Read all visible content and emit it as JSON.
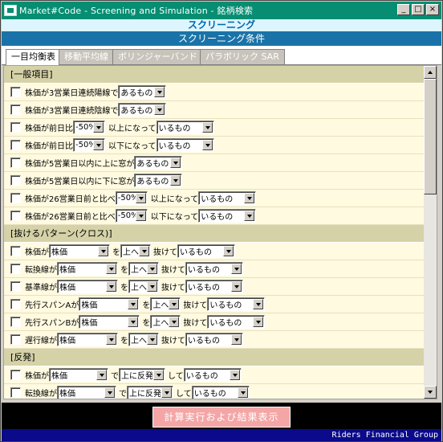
{
  "window": {
    "title": "Market#Code - Screening and Simulation -    銘柄検索"
  },
  "header": {
    "title": "スクリーニング",
    "subtitle": "スクリーニング条件"
  },
  "tabs": [
    {
      "label": "一目均衡表",
      "active": true
    },
    {
      "label": "移動平均線",
      "active": false
    },
    {
      "label": "ボリンジャーバンド",
      "active": false
    },
    {
      "label": "パラボリック SAR",
      "active": false
    }
  ],
  "sections": {
    "general": "[一般項目]",
    "cross": "[抜けるパターン(クロス)]",
    "rebound": "[反発]"
  },
  "labels": {
    "rise3": "株価が3営業日連続陽線で",
    "fall3": "株価が3営業日連続陰線で",
    "prev_ratio": "株価が前日比",
    "win_up5": "株価が5営業日以内に上に窓が",
    "win_down5": "株価が5営業日以内に下に窓が",
    "comp26": "株価が26営業日前と比べ",
    "above": "以上になって",
    "below": "以下になって",
    "stock_ga": "株価が",
    "tenkan_ga": "転換線が",
    "kijun_ga": "基準線が",
    "senkoA_ga": "先行スパンAが",
    "senkoB_ga": "先行スパンBが",
    "chikou_ga": "遅行線が",
    "wo": "を",
    "de": "で",
    "nukete": "抜けて",
    "shite": "して"
  },
  "values": {
    "arumono": "あるもの",
    "irumono": "いるもの",
    "pct": "-50%",
    "stock": "株価",
    "up": "上へ",
    "rebound_up": "上に反発"
  },
  "buttons": {
    "run": "計算実行および結果表示"
  },
  "footer": {
    "company": "Riders Financial Group"
  },
  "colors": {
    "titlebar": "#068d72",
    "header_band": "#1a73a8",
    "content_bg": "#fffae0",
    "section_bg": "#d6d2a8",
    "run_button": "#f4a6a6",
    "footer_bg": "#0a0a8a"
  }
}
